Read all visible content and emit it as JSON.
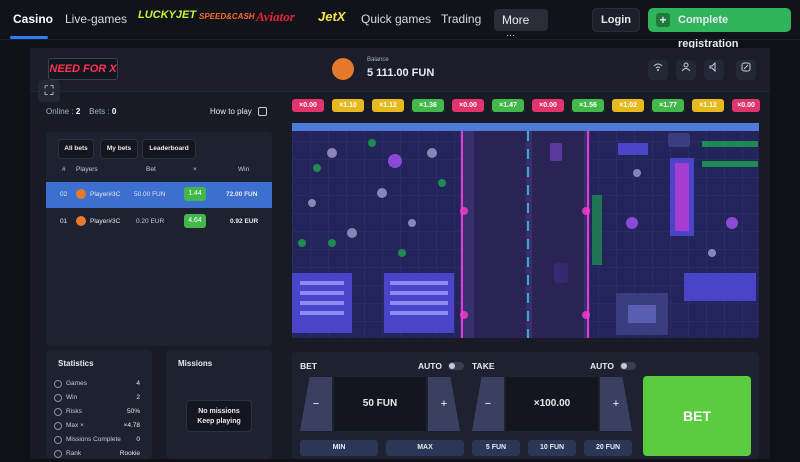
{
  "nav": {
    "items": [
      "Casino",
      "Live-games",
      "Quick games",
      "Trading"
    ],
    "brands": [
      "LUCKYJET",
      "SPEED&CASH",
      "Aviator",
      "JetX"
    ],
    "more": "More",
    "more_icon": "ellipsis-icon",
    "login": "Login",
    "register": "Complete registration"
  },
  "game": {
    "logo": "NEED FOR X",
    "balance_label": "Balance",
    "balance_value": "5 111.00 FUN",
    "online_label": "Online :",
    "online_count": "2",
    "bets_label": "Bets :",
    "bets_count": "0",
    "how_to_play": "How to play"
  },
  "history": [
    {
      "label": "×0.00",
      "color": "#e0356b"
    },
    {
      "label": "×1.10",
      "color": "#e8b81f"
    },
    {
      "label": "×1.12",
      "color": "#e8b81f"
    },
    {
      "label": "×1.36",
      "color": "#43b84a"
    },
    {
      "label": "×0.00",
      "color": "#e0356b"
    },
    {
      "label": "×1.47",
      "color": "#43b84a"
    },
    {
      "label": "×0.00",
      "color": "#e0356b"
    },
    {
      "label": "×1.56",
      "color": "#43b84a"
    },
    {
      "label": "×1.02",
      "color": "#e8b81f"
    },
    {
      "label": "×1.77",
      "color": "#43b84a"
    },
    {
      "label": "×1.12",
      "color": "#e8b81f"
    },
    {
      "label": "×0.00",
      "color": "#e0356b"
    }
  ],
  "bets_panel": {
    "tabs": [
      "All bets",
      "My bets",
      "Leaderboard"
    ],
    "columns": [
      "#",
      "Players",
      "Bet",
      "×",
      "Win"
    ],
    "rows": [
      {
        "rank": "02",
        "player": "Player#3C",
        "bet": "50.00 FUN",
        "mult": "1.44",
        "win": "72.00 FUN"
      },
      {
        "rank": "01",
        "player": "Player#3C",
        "bet": "0.20 EUR",
        "mult": "4.64",
        "win": "0.92 EUR"
      }
    ]
  },
  "statistics": {
    "title": "Statistics",
    "rows": [
      {
        "label": "Games",
        "value": "4"
      },
      {
        "label": "Win",
        "value": "2"
      },
      {
        "label": "Risks",
        "value": "50%"
      },
      {
        "label": "Max ×",
        "value": "×4.78"
      },
      {
        "label": "Missions Complete",
        "value": "0"
      },
      {
        "label": "Rank",
        "value": "Rookie"
      }
    ]
  },
  "missions": {
    "title": "Missions",
    "empty_line1": "No missions",
    "empty_line2": "Keep playing"
  },
  "bet_controls": {
    "bet_label": "BET",
    "auto_label": "AUTO",
    "take_label": "TAKE",
    "minus": "−",
    "plus": "+",
    "bet_amount": "50 FUN",
    "take_amount": "×100.00",
    "min": "MIN",
    "max": "MAX",
    "quick": [
      "5 FUN",
      "10 FUN",
      "20 FUN"
    ],
    "bet_button": "BET"
  },
  "colors": {
    "accent_blue": "#2e7cf6",
    "register_green": "#2fb35b",
    "bet_green": "#5bcc3f",
    "selected_row": "#3d6fd0"
  }
}
